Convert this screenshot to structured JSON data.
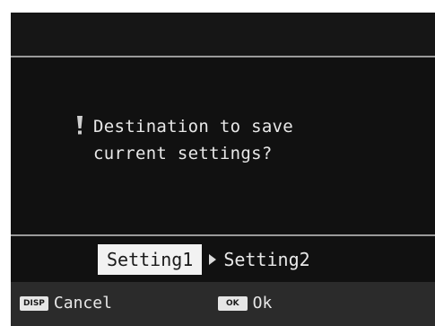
{
  "dialog": {
    "icon": "exclamation-icon",
    "message_line1": "Destination to save",
    "message_line2": "current settings?"
  },
  "options": {
    "selected": "Setting1",
    "other": "Setting2"
  },
  "footer": {
    "disp_key": "DISP",
    "cancel_label": "Cancel",
    "ok_key": "OK",
    "ok_label": "Ok"
  },
  "colors": {
    "background": "#111111",
    "text": "#e8e8e8",
    "highlight": "#f2f2f2",
    "footer": "#2b2b2b",
    "warning": "#cfcfcf"
  }
}
